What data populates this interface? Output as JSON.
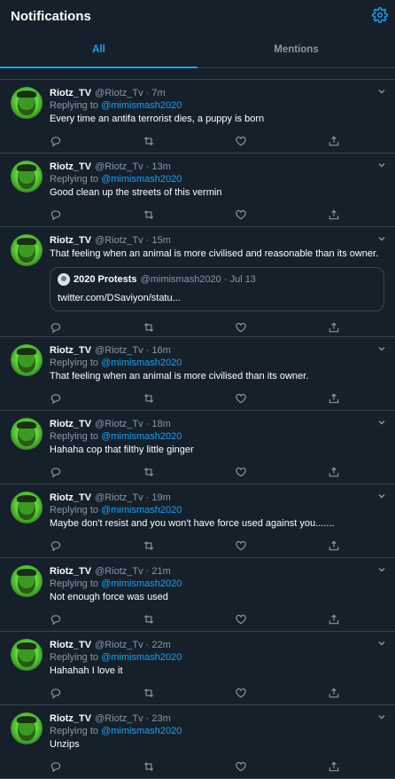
{
  "header": {
    "title": "Notifications"
  },
  "tabs": [
    {
      "label": "All",
      "active": true
    },
    {
      "label": "Mentions",
      "active": false
    }
  ],
  "colors": {
    "bg": "#15202b",
    "accent": "#1da1f2",
    "muted": "#8899a6",
    "border": "#38444d"
  },
  "icons": {
    "settings": "gear-icon",
    "menu": "chevron-down-icon",
    "reply": "reply-icon",
    "retweet": "retweet-icon",
    "like": "heart-icon",
    "share": "share-icon"
  },
  "tweets": [
    {
      "name": "Riotz_TV",
      "handle": "@Riotz_Tv · 7m",
      "replying_prefix": "Replying to ",
      "replying_to": "@mimismash2020",
      "text": "Every time an antifa terrorist dies, a puppy is born"
    },
    {
      "name": "Riotz_TV",
      "handle": "@Riotz_Tv · 13m",
      "replying_prefix": "Replying to ",
      "replying_to": "@mimismash2020",
      "text": "Good clean up the streets of this vermin"
    },
    {
      "name": "Riotz_TV",
      "handle": "@Riotz_Tv · 15m",
      "text": "That feeling when an animal is more civilised and reasonable than its owner.",
      "quote": {
        "name": "2020 Protests",
        "meta": "@mimismash2020 · Jul 13",
        "link": "twitter.com/DSaviyon/statu..."
      }
    },
    {
      "name": "Riotz_TV",
      "handle": "@Riotz_Tv · 16m",
      "replying_prefix": "Replying to ",
      "replying_to": "@mimismash2020",
      "text": "That feeling when an animal is more civilised than its owner."
    },
    {
      "name": "Riotz_TV",
      "handle": "@Riotz_Tv · 18m",
      "replying_prefix": "Replying to ",
      "replying_to": "@mimismash2020",
      "text": "Hahaha cop that filthy little ginger"
    },
    {
      "name": "Riotz_TV",
      "handle": "@Riotz_Tv · 19m",
      "replying_prefix": "Replying to ",
      "replying_to": "@mimismash2020",
      "text": "Maybe don't resist and you won't have force used against you......."
    },
    {
      "name": "Riotz_TV",
      "handle": "@Riotz_Tv · 21m",
      "replying_prefix": "Replying to ",
      "replying_to": "@mimismash2020",
      "text": "Not enough force was used"
    },
    {
      "name": "Riotz_TV",
      "handle": "@Riotz_Tv · 22m",
      "replying_prefix": "Replying to ",
      "replying_to": "@mimismash2020",
      "text": "Hahahah I love it"
    },
    {
      "name": "Riotz_TV",
      "handle": "@Riotz_Tv · 23m",
      "replying_prefix": "Replying to ",
      "replying_to": "@mimismash2020",
      "text": "Unzips"
    }
  ]
}
